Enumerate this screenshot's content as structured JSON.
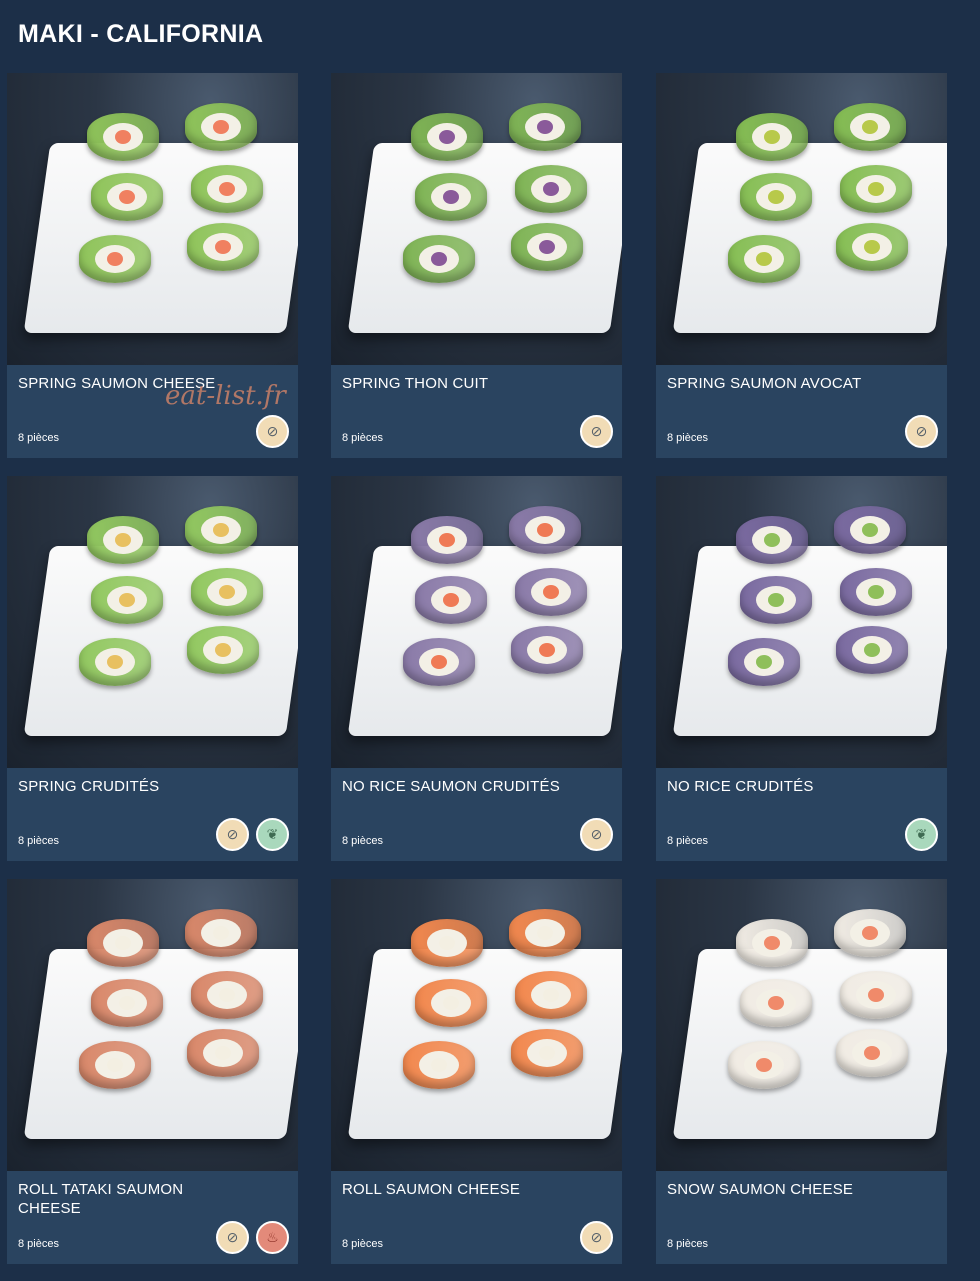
{
  "page": {
    "title": "MAKI - CALIFORNIA",
    "watermark": "eat-list.fr"
  },
  "products": [
    {
      "name": "SPRING SAUMON CHEESE",
      "pieces": "8 pièces",
      "badges": [
        "gluten-free-icon"
      ],
      "wrap_color": "#8fc45a",
      "fill_color": "#f08060"
    },
    {
      "name": "SPRING THON CUIT",
      "pieces": "8 pièces",
      "badges": [
        "gluten-free-icon"
      ],
      "wrap_color": "#7fb455",
      "fill_color": "#8a5a9a"
    },
    {
      "name": "SPRING SAUMON AVOCAT",
      "pieces": "8 pièces",
      "badges": [
        "gluten-free-icon"
      ],
      "wrap_color": "#86be54",
      "fill_color": "#b8c94a"
    },
    {
      "name": "SPRING CRUDITÉS",
      "pieces": "8 pièces",
      "badges": [
        "gluten-free-icon",
        "veggie-leaf-icon"
      ],
      "wrap_color": "#92c860",
      "fill_color": "#e8c060"
    },
    {
      "name": "NO RICE SAUMON CRUDITÉS",
      "pieces": "8 pièces",
      "badges": [
        "gluten-free-icon"
      ],
      "wrap_color": "#8a7aa8",
      "fill_color": "#ef7a55"
    },
    {
      "name": "NO RICE CRUDITÉS",
      "pieces": "8 pièces",
      "badges": [
        "veggie-leaf-icon"
      ],
      "wrap_color": "#7a6aa0",
      "fill_color": "#8fbf5a"
    },
    {
      "name": "ROLL TATAKI SAUMON CHEESE",
      "pieces": "8 pièces",
      "badges": [
        "gluten-free-icon",
        "spicy-chili-icon"
      ],
      "wrap_color": "#d9886a",
      "fill_color": "#f3efe2"
    },
    {
      "name": "ROLL SAUMON CHEESE",
      "pieces": "8 pièces",
      "badges": [
        "gluten-free-icon"
      ],
      "wrap_color": "#f2884e",
      "fill_color": "#f3efe2"
    },
    {
      "name": "SNOW SAUMON CHEESE",
      "pieces": "8 pièces",
      "badges": [],
      "wrap_color": "#f1ece4",
      "fill_color": "#f08a6a"
    }
  ],
  "badge_styles": {
    "gluten-free-icon": {
      "glyph": "⊘",
      "class": "gluten"
    },
    "veggie-leaf-icon": {
      "glyph": "❦",
      "class": "veggie"
    },
    "spicy-chili-icon": {
      "glyph": "♨",
      "class": "spicy"
    }
  }
}
